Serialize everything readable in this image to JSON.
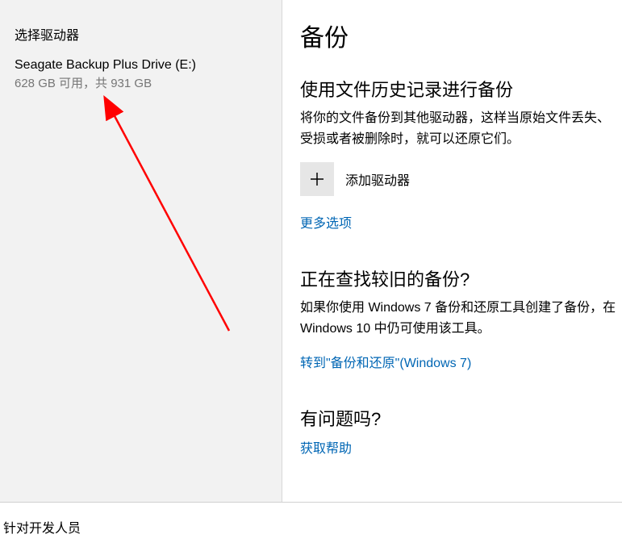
{
  "sidebar": {
    "title": "选择驱动器",
    "drive": {
      "name": "Seagate Backup Plus Drive (E:)",
      "space": "628 GB 可用，共 931 GB"
    }
  },
  "main": {
    "title": "备份",
    "section1": {
      "heading": "使用文件历史记录进行备份",
      "text": "将你的文件备份到其他驱动器，这样当原始文件丢失、受损或者被删除时，就可以还原它们。",
      "add_drive": "添加驱动器",
      "more_options": "更多选项"
    },
    "section2": {
      "heading": "正在查找较旧的备份?",
      "text": "如果你使用 Windows 7 备份和还原工具创建了备份，在 Windows 10 中仍可使用该工具。",
      "link": "转到\"备份和还原\"(Windows 7)"
    },
    "section3": {
      "heading": "有问题吗?",
      "link": "获取帮助"
    }
  },
  "footer": {
    "text": "针对开发人员"
  }
}
